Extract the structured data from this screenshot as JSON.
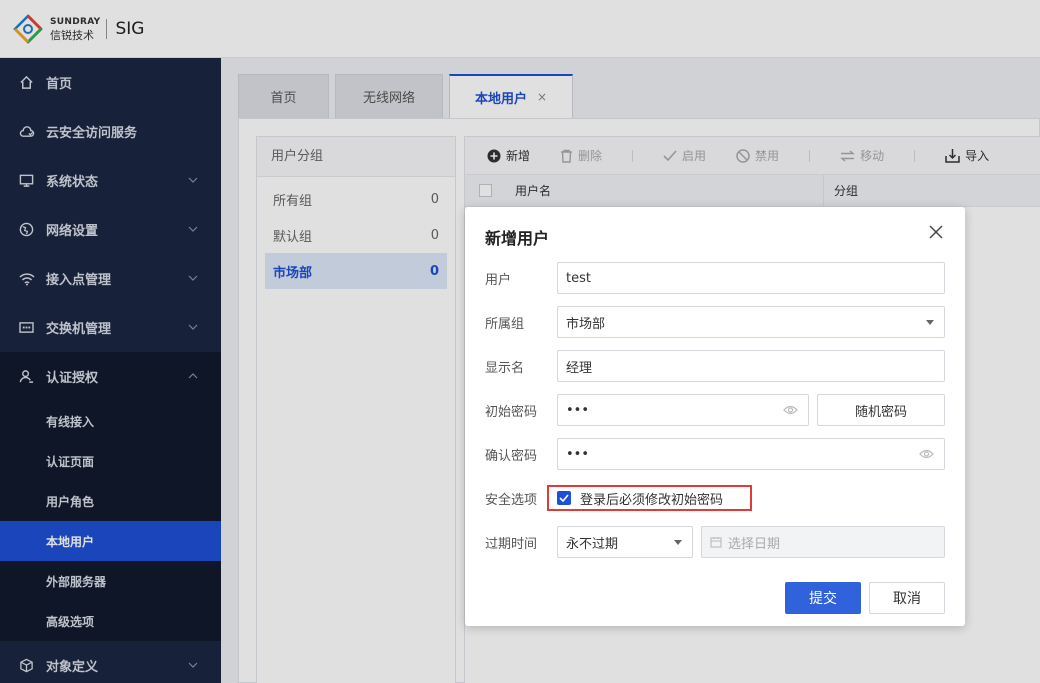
{
  "brand": {
    "en": "SUNDRAY",
    "cn": "信锐技术",
    "product": "SIG",
    "logo_colors": [
      "#e8442e",
      "#f5a623",
      "#2fb34a",
      "#1e7fd1"
    ]
  },
  "sidebar": {
    "items": [
      {
        "label": "首页",
        "icon": "home-icon"
      },
      {
        "label": "云安全访问服务",
        "icon": "cloud-shield-icon"
      },
      {
        "label": "系统状态",
        "icon": "monitor-icon"
      },
      {
        "label": "网络设置",
        "icon": "globe-icon"
      },
      {
        "label": "接入点管理",
        "icon": "wifi-icon"
      },
      {
        "label": "交换机管理",
        "icon": "switch-icon"
      },
      {
        "label": "认证授权",
        "icon": "user-auth-icon"
      }
    ],
    "sub_items": [
      "有线接入",
      "认证页面",
      "用户角色",
      "本地用户",
      "外部服务器",
      "高级选项"
    ],
    "last_item": {
      "label": "对象定义",
      "icon": "cube-icon"
    },
    "active_sub": "本地用户"
  },
  "tabs": [
    {
      "label": "首页"
    },
    {
      "label": "无线网络"
    },
    {
      "label": "本地用户",
      "close": "×"
    }
  ],
  "groups": {
    "header": "用户分组",
    "items": [
      {
        "name": "所有组",
        "count": "0"
      },
      {
        "name": "默认组",
        "count": "0"
      },
      {
        "name": "市场部",
        "count": "0"
      }
    ]
  },
  "toolbar": {
    "add": "新增",
    "delete": "删除",
    "enable": "启用",
    "disable": "禁用",
    "move": "移动",
    "import": "导入"
  },
  "table": {
    "columns": [
      "用户名",
      "分组"
    ]
  },
  "modal": {
    "title": "新增用户",
    "user_label": "用户",
    "user_value": "test",
    "group_label": "所属组",
    "group_value": "市场部",
    "display_label": "显示名",
    "display_value": "经理",
    "init_pwd_label": "初始密码",
    "init_pwd_value": "•••",
    "random_pwd_button": "随机密码",
    "confirm_pwd_label": "确认密码",
    "confirm_pwd_value": "•••",
    "security_label": "安全选项",
    "security_option": "登录后必须修改初始密码",
    "security_checked": true,
    "expire_label": "过期时间",
    "expire_value": "永不过期",
    "date_placeholder": "选择日期",
    "submit": "提交",
    "cancel": "取消"
  },
  "colors": {
    "accent": "#1f4fd4",
    "sidebar_bg": "#1b2641",
    "highlight": "#e03a3a"
  }
}
